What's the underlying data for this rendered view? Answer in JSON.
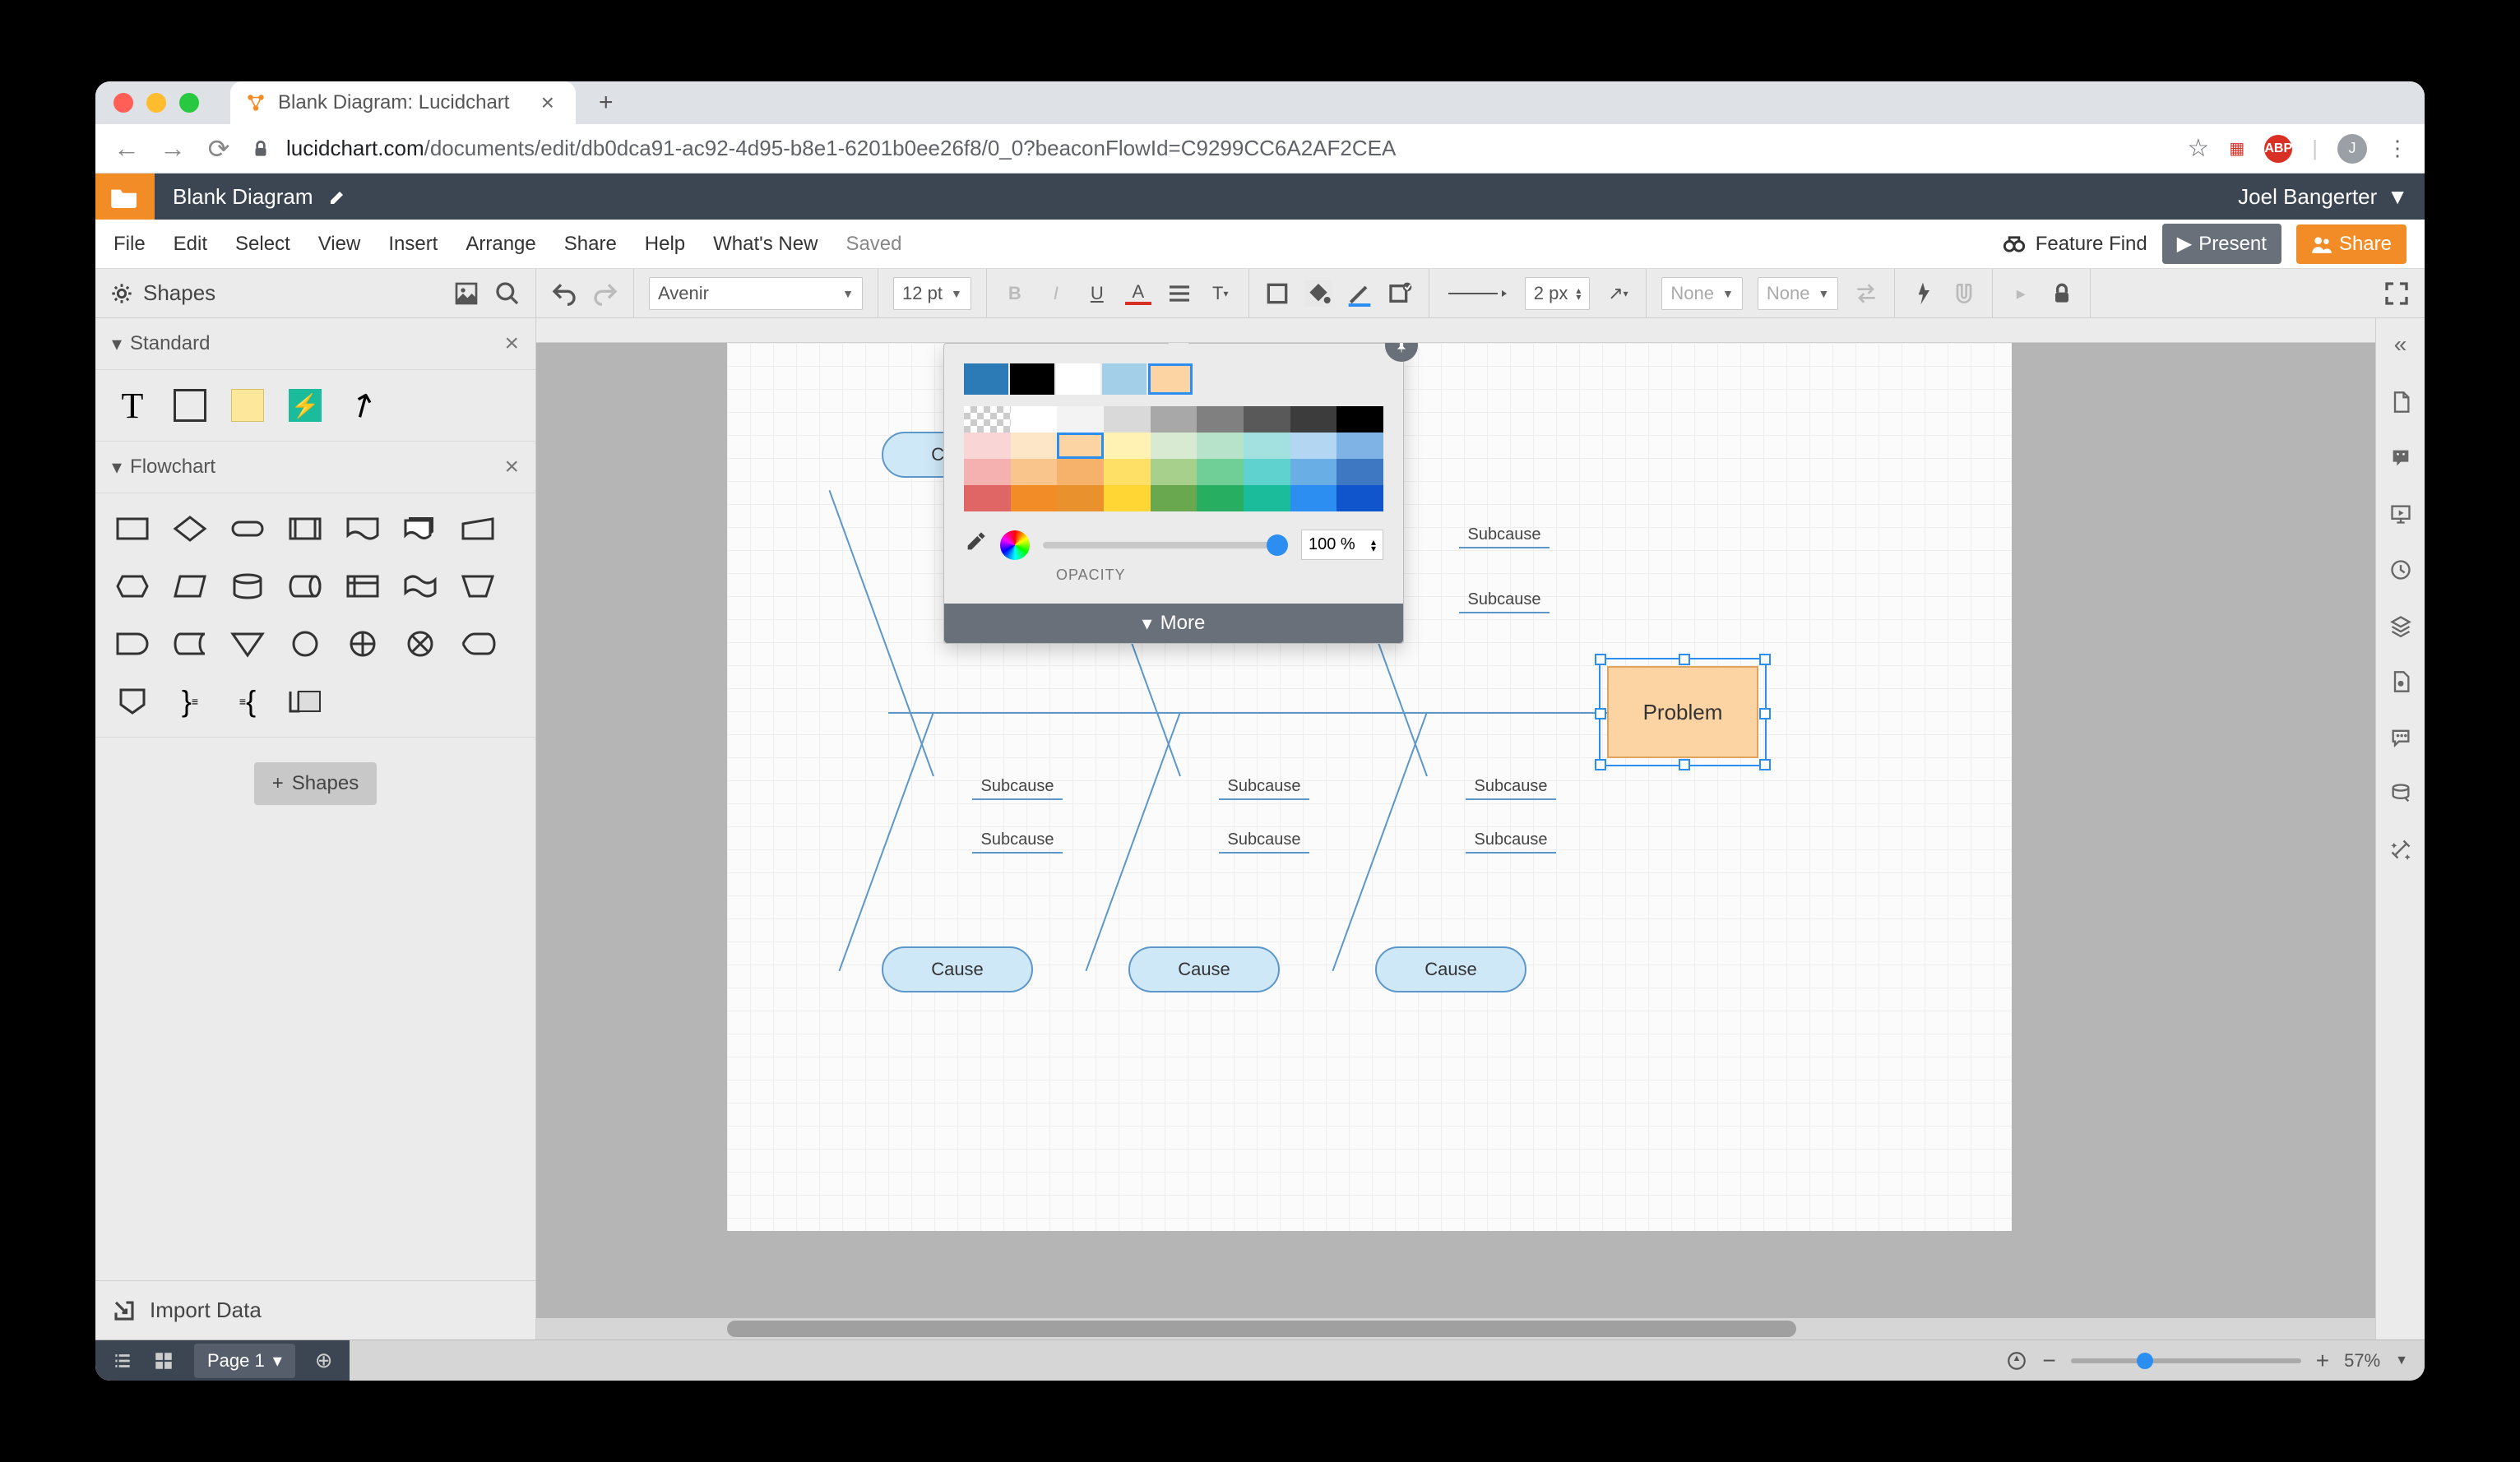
{
  "browser": {
    "tab_title": "Blank Diagram: Lucidchart",
    "url_domain": "lucidchart.com",
    "url_path": "/documents/edit/db0dca91-ac92-4d95-b8e1-6201b0ee26f8/0_0?beaconFlowId=C9299CC6A2AF2CEA",
    "avatar_letter": "J"
  },
  "header": {
    "doc_title": "Blank Diagram",
    "user_name": "Joel Bangerter"
  },
  "menu": {
    "items": [
      "File",
      "Edit",
      "Select",
      "View",
      "Insert",
      "Arrange",
      "Share",
      "Help",
      "What's New"
    ],
    "saved": "Saved",
    "feature_find": "Feature Find",
    "present": "Present",
    "share": "Share"
  },
  "toolbar": {
    "shapes_label": "Shapes",
    "font": "Avenir",
    "font_size": "12 pt",
    "line_width": "2 px",
    "none1": "None",
    "none2": "None"
  },
  "sidebar": {
    "libs": [
      {
        "name": "Standard"
      },
      {
        "name": "Flowchart"
      }
    ],
    "add_shapes": "Shapes",
    "import": "Import Data"
  },
  "diagram": {
    "cause_label": "Cause",
    "subcause_label": "Subcause",
    "problem_label": "Problem"
  },
  "color_popover": {
    "recent_swatches": [
      "#2c7bb6",
      "#000000",
      "#ffffff",
      "#a3cfe8",
      "#fcd4a3"
    ],
    "selected_recent_index": 4,
    "palette": [
      "checker",
      "#ffffff",
      "#f3f3f3",
      "#d9d9d9",
      "#a8a8a8",
      "#808080",
      "#595959",
      "#3c3c3c",
      "#000000",
      "#f9d6d5",
      "#fde6c8",
      "#fcd4a3",
      "#fff2b3",
      "#d9ead3",
      "#b6e3c9",
      "#a3e1e0",
      "#b3d7f2",
      "#7fb2e5",
      "#f4b1af",
      "#f9c58d",
      "#f6b26b",
      "#ffe066",
      "#a8d08d",
      "#6fcf97",
      "#5fd2d0",
      "#6aaee6",
      "#3e78c2",
      "#e06666",
      "#f28c26",
      "#e8912d",
      "#ffd633",
      "#6aa84f",
      "#27ae60",
      "#1abc9c",
      "#2c8ef0",
      "#1155cc"
    ],
    "selected_palette_index": 11,
    "opacity_value": "100 %",
    "opacity_label": "OPACITY",
    "more": "More"
  },
  "bottom": {
    "page_label": "Page 1",
    "zoom_value": "57%"
  }
}
